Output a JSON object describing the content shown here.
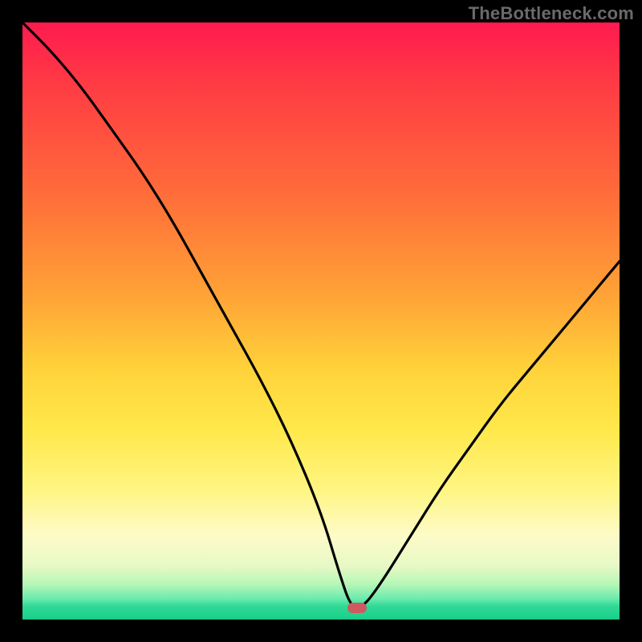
{
  "watermark": "TheBottleneck.com",
  "colors": {
    "background": "#000000",
    "curve": "#000000",
    "marker": "#cc5a5e",
    "gradient_top": "#ff1a4f",
    "gradient_bottom": "#17cf8a"
  },
  "chart_data": {
    "type": "line",
    "title": "",
    "xlabel": "",
    "ylabel": "",
    "xlim": [
      0,
      100
    ],
    "ylim": [
      0,
      100
    ],
    "marker": {
      "x": 56,
      "y": 2
    },
    "x": [
      0,
      5,
      10,
      15,
      20,
      25,
      30,
      35,
      40,
      45,
      50,
      53,
      55,
      57,
      60,
      65,
      70,
      75,
      80,
      85,
      90,
      95,
      100
    ],
    "values": [
      100,
      95,
      89,
      82,
      75,
      67,
      58,
      49,
      40,
      30,
      18,
      8,
      2,
      2,
      6,
      14,
      22,
      29,
      36,
      42,
      48,
      54,
      60
    ],
    "note": "Ticks and numeric axis labels are not shown in the image; x and y are normalized 0-100 positions read from the plot area. The curve descends steeply from top-left, reaches ~0 near x≈55-57 (marker), then rises with a gentler convex curve toward the right edge reaching ~60% height."
  }
}
